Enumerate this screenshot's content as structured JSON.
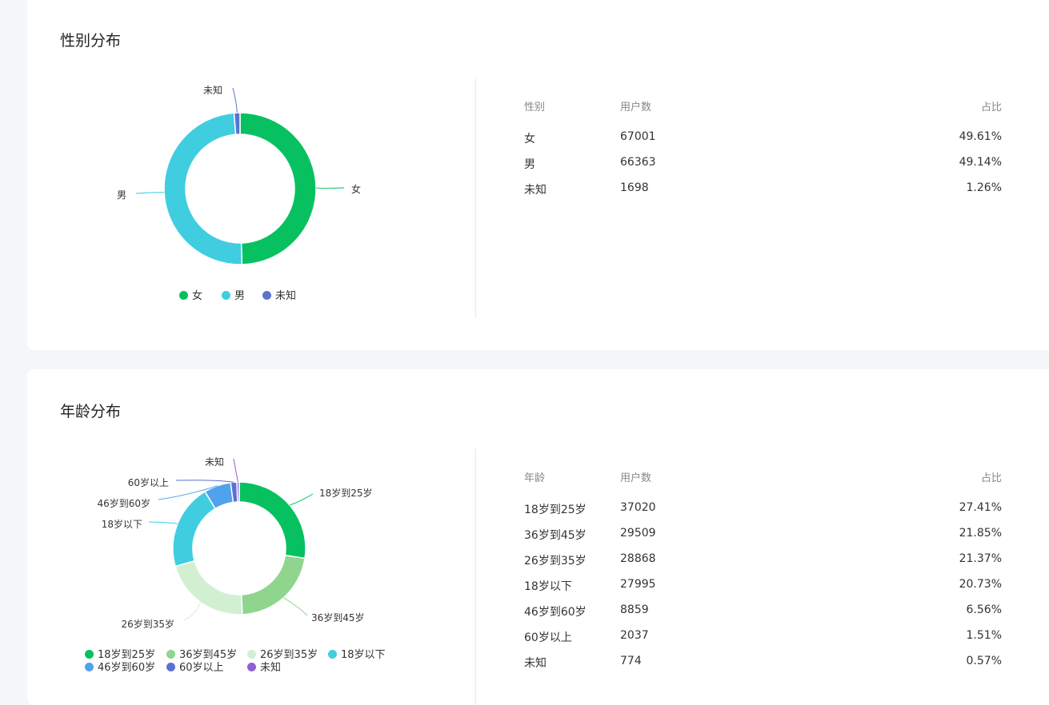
{
  "gender": {
    "title": "性别分布",
    "headers": {
      "category": "性别",
      "users": "用户数",
      "ratio": "占比"
    },
    "rows": [
      {
        "name": "女",
        "users": "67001",
        "ratio": "49.61%"
      },
      {
        "name": "男",
        "users": "66363",
        "ratio": "49.14%"
      },
      {
        "name": "未知",
        "users": "1698",
        "ratio": "1.26%"
      }
    ]
  },
  "age": {
    "title": "年龄分布",
    "headers": {
      "category": "年龄",
      "users": "用户数",
      "ratio": "占比"
    },
    "rows": [
      {
        "name": "18岁到25岁",
        "users": "37020",
        "ratio": "27.41%"
      },
      {
        "name": "36岁到45岁",
        "users": "29509",
        "ratio": "21.85%"
      },
      {
        "name": "26岁到35岁",
        "users": "28868",
        "ratio": "21.37%"
      },
      {
        "name": "18岁以下",
        "users": "27995",
        "ratio": "20.73%"
      },
      {
        "name": "46岁到60岁",
        "users": "8859",
        "ratio": "6.56%"
      },
      {
        "name": "60岁以上",
        "users": "2037",
        "ratio": "1.51%"
      },
      {
        "name": "未知",
        "users": "774",
        "ratio": "0.57%"
      }
    ]
  },
  "chart_data": [
    {
      "type": "pie",
      "title": "性别分布",
      "categories": [
        "女",
        "男",
        "未知"
      ],
      "values": [
        67001,
        66363,
        1698
      ],
      "colors": [
        "#07c160",
        "#40cde0",
        "#5b73cf"
      ],
      "legend": "bottom"
    },
    {
      "type": "pie",
      "title": "年龄分布",
      "categories": [
        "18岁到25岁",
        "36岁到45岁",
        "26岁到35岁",
        "18岁以下",
        "46岁到60岁",
        "60岁以上",
        "未知"
      ],
      "values": [
        37020,
        29509,
        28868,
        27995,
        8859,
        2037,
        774
      ],
      "colors": [
        "#07c160",
        "#8fd58e",
        "#d2efd2",
        "#40cde0",
        "#4fa2ec",
        "#5b6fd4",
        "#8f60d0"
      ],
      "legend": "bottom"
    }
  ]
}
